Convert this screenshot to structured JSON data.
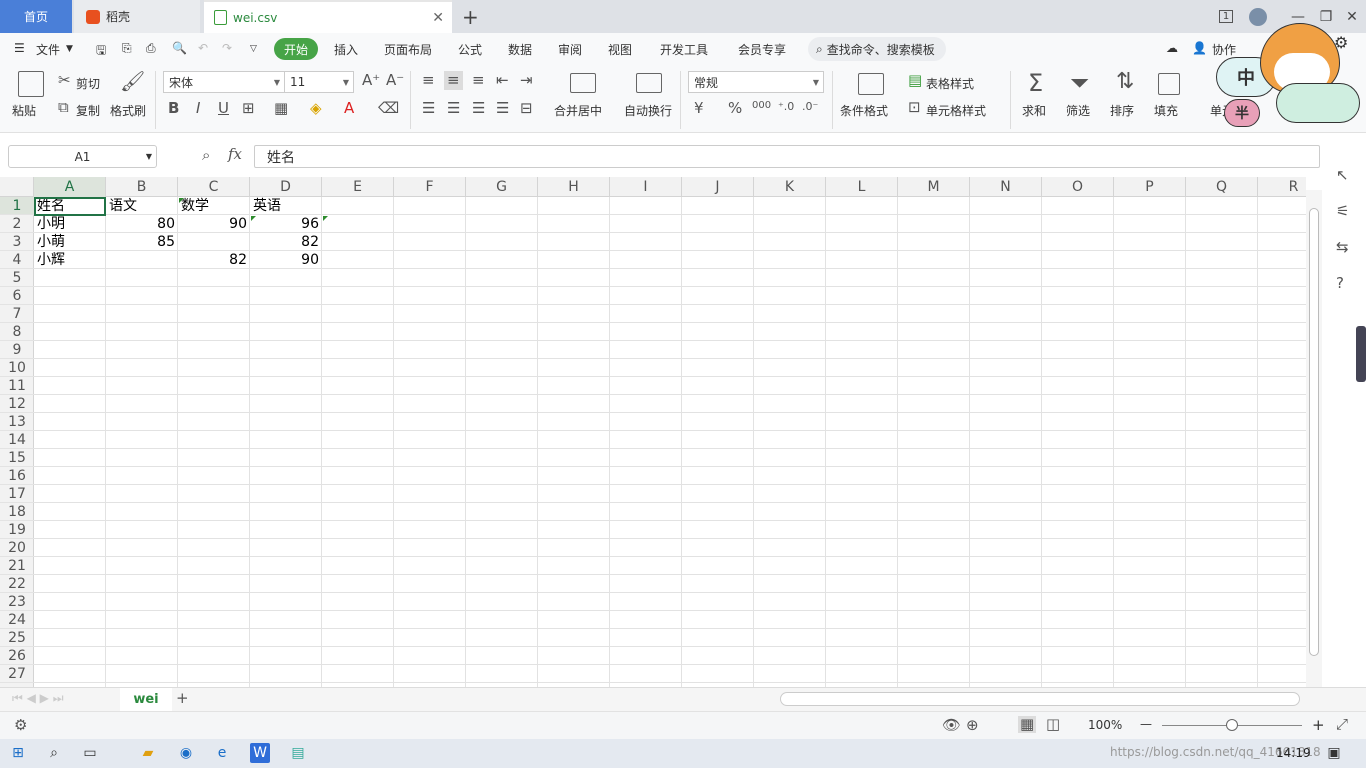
{
  "tabs": {
    "home": "首页",
    "daoke": "稻壳",
    "file": "wei.csv",
    "new_tab": "+"
  },
  "window": {
    "badge": "1",
    "minimize": "—",
    "restore": "❐",
    "close": "✕"
  },
  "menu": {
    "file": "文件",
    "items": [
      "开始",
      "插入",
      "页面布局",
      "公式",
      "数据",
      "审阅",
      "视图",
      "开发工具",
      "会员专享"
    ],
    "search": "查找命令、搜索模板",
    "collab": "协作"
  },
  "ribbon": {
    "paste": "粘贴",
    "cut": "剪切",
    "copy": "复制",
    "format_painter": "格式刷",
    "font_name": "宋体",
    "font_size": "11",
    "merge_center": "合并居中",
    "wrap_text": "自动换行",
    "number_format": "常规",
    "conditional_format": "条件格式",
    "table_style": "表格样式",
    "cell_style": "单元格样式",
    "sum": "求和",
    "filter": "筛选",
    "sort": "排序",
    "fill": "填充",
    "cell": "单元格",
    "currency": "¥",
    "percent": "%",
    "thousands": "000",
    "ime_char1": "中",
    "ime_char2": "半"
  },
  "formula_bar": {
    "name_box": "A1",
    "fx": "fx",
    "content": "姓名"
  },
  "sheet": {
    "columns": [
      "A",
      "B",
      "C",
      "D",
      "E",
      "F",
      "G",
      "H",
      "I",
      "J",
      "K",
      "L",
      "M",
      "N",
      "O",
      "P",
      "Q",
      "R"
    ],
    "rows": [
      "1",
      "2",
      "3",
      "4",
      "5",
      "6",
      "7",
      "8",
      "9",
      "10",
      "11",
      "12",
      "13",
      "14",
      "15",
      "16",
      "17",
      "18",
      "19",
      "20",
      "21",
      "22",
      "23",
      "24",
      "25",
      "26",
      "27"
    ],
    "data": [
      [
        "姓名",
        "语文",
        "数学",
        "英语"
      ],
      [
        "小明",
        "80",
        "90",
        "96"
      ],
      [
        "小萌",
        "85",
        "",
        "82"
      ],
      [
        "小辉",
        "",
        "82",
        "90"
      ]
    ],
    "sheet_tab": "wei",
    "add_sheet": "+"
  },
  "status": {
    "zoom": "100%",
    "zoom_minus": "—",
    "zoom_plus": "+"
  },
  "taskbar": {
    "time": "14:19",
    "watermark": "https://blog.csdn.net/qq_41661818"
  },
  "colors": {
    "accent": "#47a447",
    "home_tab": "#4a7fd8",
    "selection": "#217346"
  }
}
